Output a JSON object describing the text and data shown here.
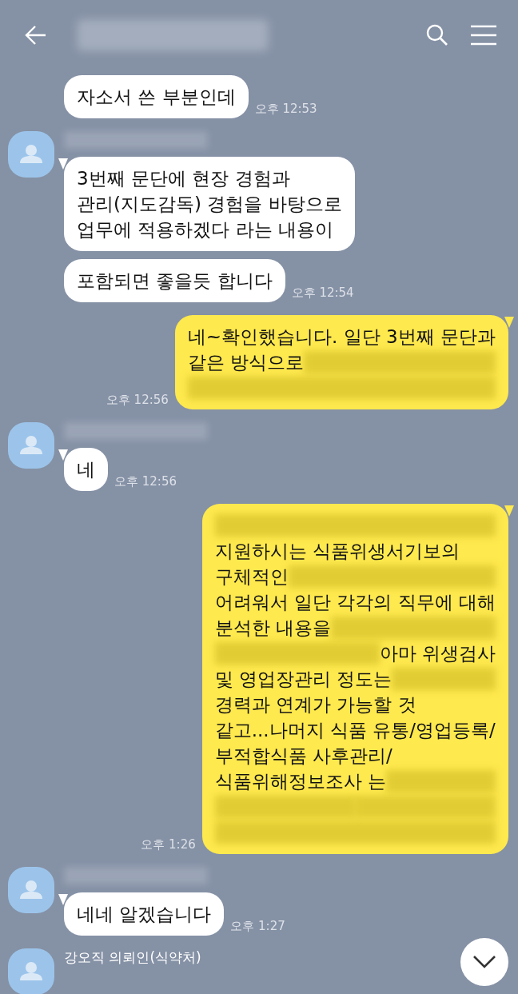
{
  "header": {
    "title_redacted": true
  },
  "groups": [
    {
      "kind": "incoming",
      "avatar": false,
      "messages": [
        {
          "tail": false,
          "time": "오후 12:53",
          "lines": [
            [
              {
                "kind": "text",
                "text": "자소서 쓴 부분인데"
              }
            ]
          ]
        }
      ]
    },
    {
      "kind": "incoming",
      "avatar": true,
      "name_redacted": true,
      "messages": [
        {
          "tail": true,
          "lines": [
            [
              {
                "kind": "text",
                "text": "3번째 문단에 현장 경험과"
              }
            ],
            [
              {
                "kind": "text",
                "text": "관리(지도감독) 경험을 바탕으로"
              }
            ],
            [
              {
                "kind": "text",
                "text": "업무에 적용하겠다 라는 내용이"
              }
            ]
          ]
        },
        {
          "tail": false,
          "time": "오후 12:54",
          "lines": [
            [
              {
                "kind": "text",
                "text": "포함되면 좋을듯 합니다"
              }
            ]
          ]
        }
      ]
    },
    {
      "kind": "outgoing",
      "avatar": false,
      "messages": [
        {
          "tail": true,
          "time": "오후 12:56",
          "lines": [
            [
              {
                "kind": "text",
                "text": "네~확인했습니다. 일단 3번째 문단과"
              }
            ],
            [
              {
                "kind": "text",
                "text": "같은 방식으로 "
              },
              {
                "kind": "redacted"
              }
            ],
            [
              {
                "kind": "redacted"
              }
            ]
          ]
        }
      ]
    },
    {
      "kind": "incoming",
      "avatar": true,
      "name_redacted": true,
      "messages": [
        {
          "tail": true,
          "time": "오후 12:56",
          "lines": [
            [
              {
                "kind": "text",
                "text": "네"
              }
            ]
          ]
        }
      ]
    },
    {
      "kind": "outgoing",
      "avatar": false,
      "messages": [
        {
          "tail": true,
          "time": "오후 1:26",
          "lines": [
            [
              {
                "kind": "redacted"
              }
            ],
            [
              {
                "kind": "text",
                "text": "지원하시는 식품위생서기보의"
              }
            ],
            [
              {
                "kind": "text",
                "text": "구체적인"
              },
              {
                "kind": "redacted"
              }
            ],
            [
              {
                "kind": "text",
                "text": "어려워서 일단 각각의 직무에 대해"
              }
            ],
            [
              {
                "kind": "text",
                "text": "분석한 내용을"
              },
              {
                "kind": "redacted"
              }
            ],
            [
              {
                "kind": "redacted"
              },
              {
                "kind": "text",
                "text": " 아마 위생검사"
              }
            ],
            [
              {
                "kind": "text",
                "text": "및 영업장관리 정도는"
              },
              {
                "kind": "redacted"
              }
            ],
            [
              {
                "kind": "text",
                "text": "경력과 연계가 가능할 것"
              }
            ],
            [
              {
                "kind": "text",
                "text": "같고...나머지 식품 유통/영업등록/"
              }
            ],
            [
              {
                "kind": "text",
                "text": "부적합식품 사후관리/"
              }
            ],
            [
              {
                "kind": "text",
                "text": "식품위해정보조사 는 "
              },
              {
                "kind": "redacted"
              }
            ],
            [
              {
                "kind": "redacted"
              },
              {
                "kind": "redacted"
              }
            ],
            [
              {
                "kind": "redacted"
              }
            ]
          ]
        }
      ]
    },
    {
      "kind": "incoming",
      "avatar": true,
      "name_redacted": true,
      "messages": [
        {
          "tail": true,
          "time": "오후 1:27",
          "lines": [
            [
              {
                "kind": "text",
                "text": "네네 알겠습니다"
              }
            ]
          ]
        }
      ]
    },
    {
      "kind": "incoming",
      "avatar": true,
      "name": "강오직 의뢰인(식약처)"
    }
  ],
  "scroll_down_button": true
}
